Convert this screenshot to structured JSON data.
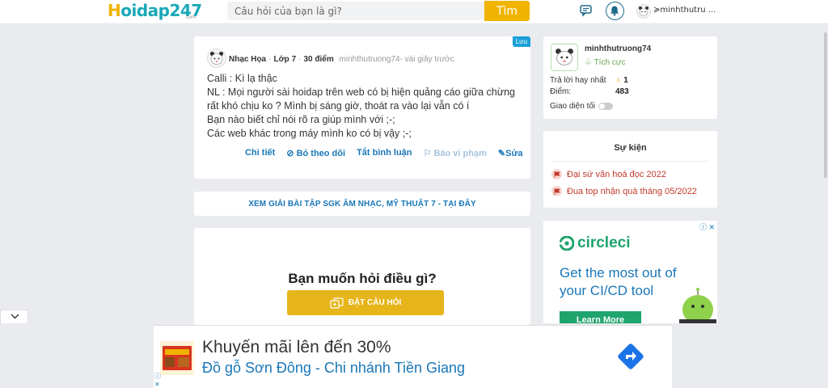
{
  "header": {
    "logo_main": "oidap247",
    "logo_h": "H",
    "logo_suffix": ".com",
    "search_placeholder": "Câu hỏi của bạn là gì?",
    "search_button": "Tìm",
    "username": "minhthutru ..."
  },
  "question": {
    "save_label": "Lưu",
    "subject": "Nhạc Họa",
    "grade": "Lớp 7",
    "points": "30 điểm",
    "author": "minhthutruong74",
    "time": "- vài giây trước",
    "lines": [
      "Calli  : Kì lạ thậc",
      "NL : Mọi người sài hoidap trên web có bị hiện quảng cáo giữa chừng rất khó chịu ko ? Mình bị sáng giờ, thoát ra vào lại vẫn có í",
      "Bạn nào biết chỉ nói rõ ra giúp mình với ;-;",
      "Các web khác trong máy mình ko có bị vậy ;-;"
    ],
    "actions": {
      "detail": "Chi tiết",
      "unfollow": "Bỏ theo dõi",
      "disable_comments": "Tắt bình luận",
      "report": "Báo vi phạm",
      "edit": "Sửa"
    }
  },
  "banner": {
    "text": "XEM GIẢI BÀI TẬP SGK ÂM NHẠC, MỸ THUẬT 7 - TẠI ĐÂY"
  },
  "ask": {
    "title": "Bạn muốn hỏi điều gì?",
    "button": "ĐẶT CÂU HỎI"
  },
  "profile": {
    "name": "minhthutruong74",
    "rank": "Tích cực",
    "best_answer_label": "Trả lời hay nhất",
    "best_answer_value": "1",
    "points_label": "Điểm:",
    "points_value": "483",
    "dark_mode_label": "Giao diện tối"
  },
  "events": {
    "title": "Sự kiện",
    "items": [
      "Đại sứ văn hoá đọc 2022",
      "Đua top nhận quà tháng 05/2022"
    ]
  },
  "ad_circle": {
    "brand": "circleci",
    "tagline": "Get the most out of your CI/CD tool",
    "button": "Learn More",
    "close": "ⓘ ✕"
  },
  "bottom_ad": {
    "title": "Khuyến mãi lên đến 30%",
    "subtitle": "Đồ gỗ Sơn Đông - Chi nhánh Tiền Giang",
    "info": "ⓘ",
    "close": "✕"
  },
  "colors": {
    "accent_yellow": "#f0b400",
    "link_blue": "#1a77b8",
    "event_red": "#c0392b",
    "circleci_green": "#1ea46c"
  }
}
